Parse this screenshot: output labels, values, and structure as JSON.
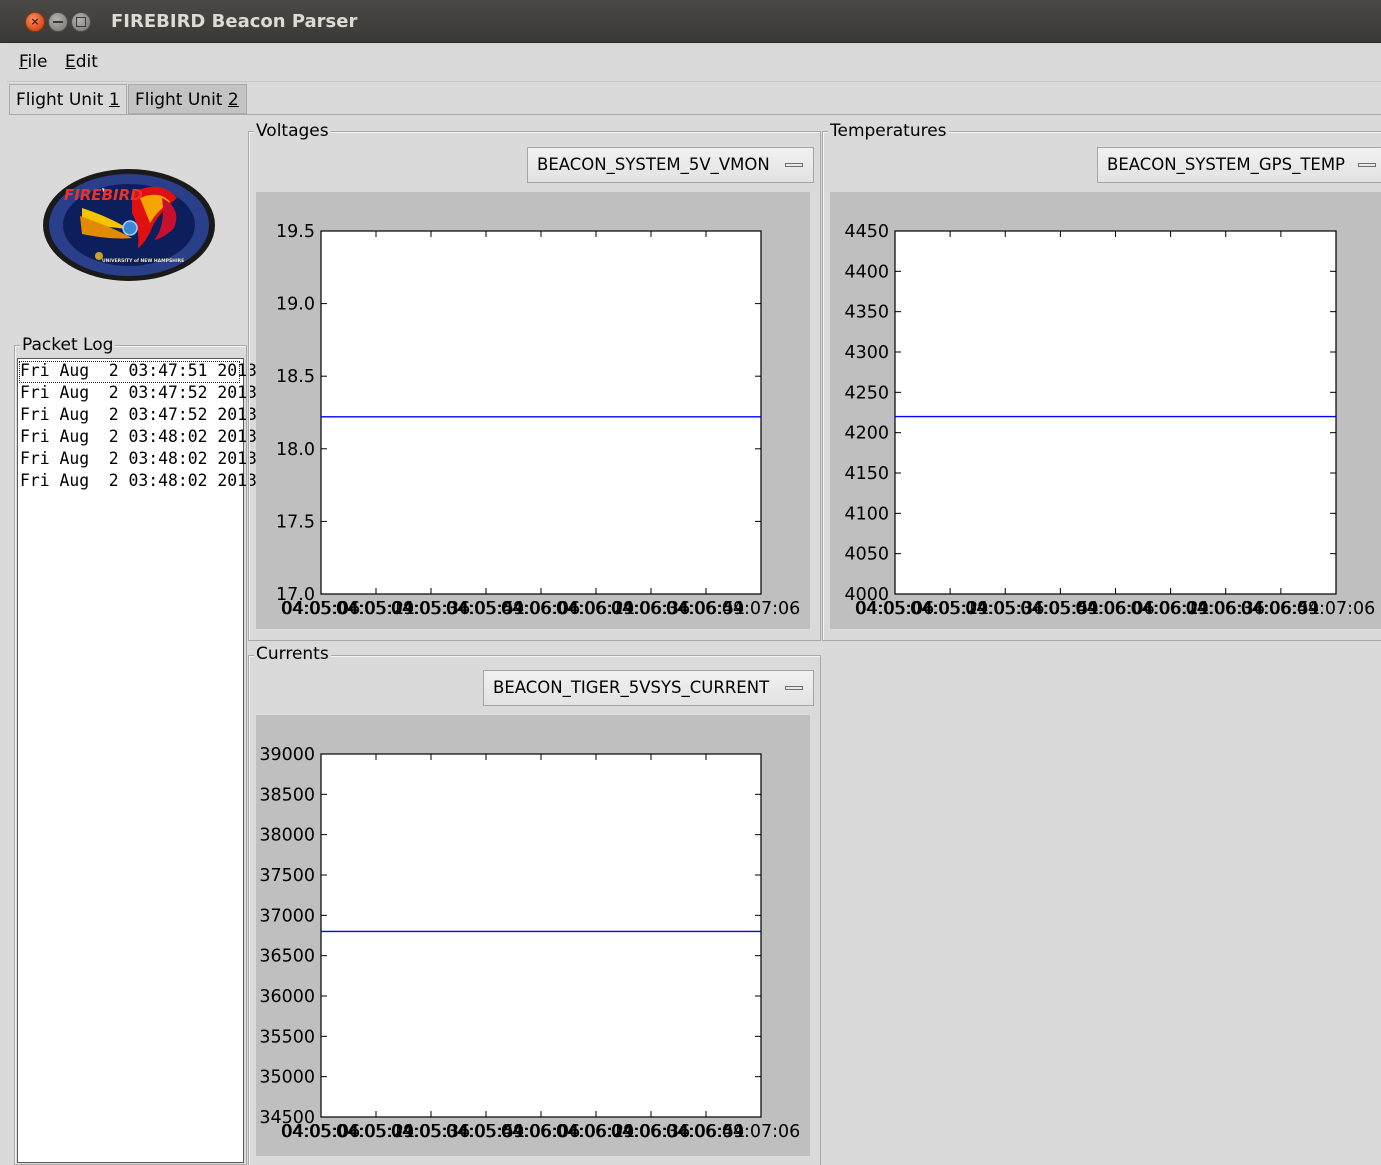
{
  "window": {
    "title": "FIREBIRD Beacon Parser",
    "close_glyph": "×"
  },
  "menubar": {
    "file_mnemonic": "F",
    "file_rest": "ile",
    "edit_mnemonic": "E",
    "edit_rest": "dit"
  },
  "tabs": [
    {
      "label": "Flight Unit ",
      "mnemonic": "1",
      "selected": true
    },
    {
      "label": "Flight Unit ",
      "mnemonic": "2",
      "selected": false
    }
  ],
  "logo": {
    "text": "FIREBIRD",
    "subtext": "UNIVERSITY of NEW HAMPSHIRE"
  },
  "packet_log": {
    "title": "Packet Log",
    "entries": [
      "Fri Aug  2 03:47:51 2013",
      "Fri Aug  2 03:47:52 2013",
      "Fri Aug  2 03:47:52 2013",
      "Fri Aug  2 03:48:02 2013",
      "Fri Aug  2 03:48:02 2013",
      "Fri Aug  2 03:48:02 2013"
    ]
  },
  "voltages": {
    "title": "Voltages",
    "selected_channel": "BEACON_SYSTEM_5V_VMON"
  },
  "temperatures": {
    "title": "Temperatures",
    "selected_channel": "BEACON_SYSTEM_GPS_TEMP"
  },
  "currents": {
    "title": "Currents",
    "selected_channel": "BEACON_TIGER_5VSYS_CURRENT"
  },
  "colors": {
    "line": "#0000ff",
    "plot_bg": "#bfbfbf"
  },
  "chart_data": [
    {
      "type": "line",
      "title": "",
      "xlabel": "",
      "ylabel": "",
      "x_ticks": [
        "04:05:06",
        "04:05:21",
        "04:05:36",
        "04:05:51",
        "04:06:06",
        "04:06:21",
        "04:06:36",
        "04:06:51",
        "04:07:06"
      ],
      "x_tick_overlay": [
        "04:05:04",
        "04:05:19",
        "04:05:34",
        "04:05:49",
        "04:06:04",
        "04:06:19",
        "04:06:34",
        "04:06:49"
      ],
      "y_ticks": [
        "17.0",
        "17.5",
        "18.0",
        "18.5",
        "19.0",
        "19.5"
      ],
      "ylim": [
        17.0,
        19.5
      ],
      "grid": false,
      "series": [
        {
          "values": [
            18.22,
            18.22
          ]
        }
      ]
    },
    {
      "type": "line",
      "title": "",
      "xlabel": "",
      "ylabel": "",
      "x_ticks": [
        "04:05:06",
        "04:05:21",
        "04:05:36",
        "04:05:51",
        "04:06:06",
        "04:06:21",
        "04:06:36",
        "04:06:51",
        "04:07:06"
      ],
      "x_tick_overlay": [
        "04:05:04",
        "04:05:19",
        "04:05:34",
        "04:05:49",
        "04:06:04",
        "04:06:19",
        "04:06:34",
        "04:06:49"
      ],
      "y_ticks": [
        "4000",
        "4050",
        "4100",
        "4150",
        "4200",
        "4250",
        "4300",
        "4350",
        "4400",
        "4450"
      ],
      "ylim": [
        4000,
        4450
      ],
      "grid": false,
      "series": [
        {
          "values": [
            4220,
            4220
          ]
        }
      ]
    },
    {
      "type": "line",
      "title": "",
      "xlabel": "",
      "ylabel": "",
      "x_ticks": [
        "04:05:06",
        "04:05:21",
        "04:05:36",
        "04:05:51",
        "04:06:06",
        "04:06:21",
        "04:06:36",
        "04:06:51",
        "04:07:06"
      ],
      "x_tick_overlay": [
        "04:05:04",
        "04:05:19",
        "04:05:34",
        "04:05:49",
        "04:06:04",
        "04:06:19",
        "04:06:34",
        "04:06:49"
      ],
      "y_ticks": [
        "34500",
        "35000",
        "35500",
        "36000",
        "36500",
        "37000",
        "37500",
        "38000",
        "38500",
        "39000"
      ],
      "ylim": [
        34500,
        39000
      ],
      "grid": false,
      "series": [
        {
          "values": [
            36800,
            36800
          ]
        }
      ]
    }
  ]
}
